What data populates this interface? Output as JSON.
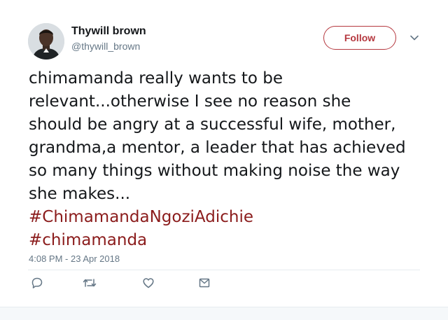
{
  "author": {
    "name": "Thywill brown",
    "handle": "@thywill_brown",
    "avatar_icon": "user-avatar-photo"
  },
  "follow_button": {
    "label": "Follow",
    "color": "#b5383f"
  },
  "menu": {
    "icon": "chevron-down-icon"
  },
  "tweet": {
    "lines": [
      "chimamanda really wants to be",
      "relevant...otherwise I see no reason she",
      "should be angry at a successful  wife, mother,",
      "grandma,a mentor, a leader that has achieved",
      "so many things without making noise the way",
      "she makes..."
    ],
    "hashtags": [
      "#ChimamandaNgoziAdichie",
      "#chimamanda"
    ],
    "hashtag_color": "#8b1c1c",
    "timestamp": "4:08 PM - 23 Apr 2018"
  },
  "actions": [
    {
      "name": "reply",
      "icon": "reply-icon"
    },
    {
      "name": "retweet",
      "icon": "retweet-icon"
    },
    {
      "name": "like",
      "icon": "heart-icon"
    },
    {
      "name": "direct-message",
      "icon": "envelope-icon"
    }
  ]
}
